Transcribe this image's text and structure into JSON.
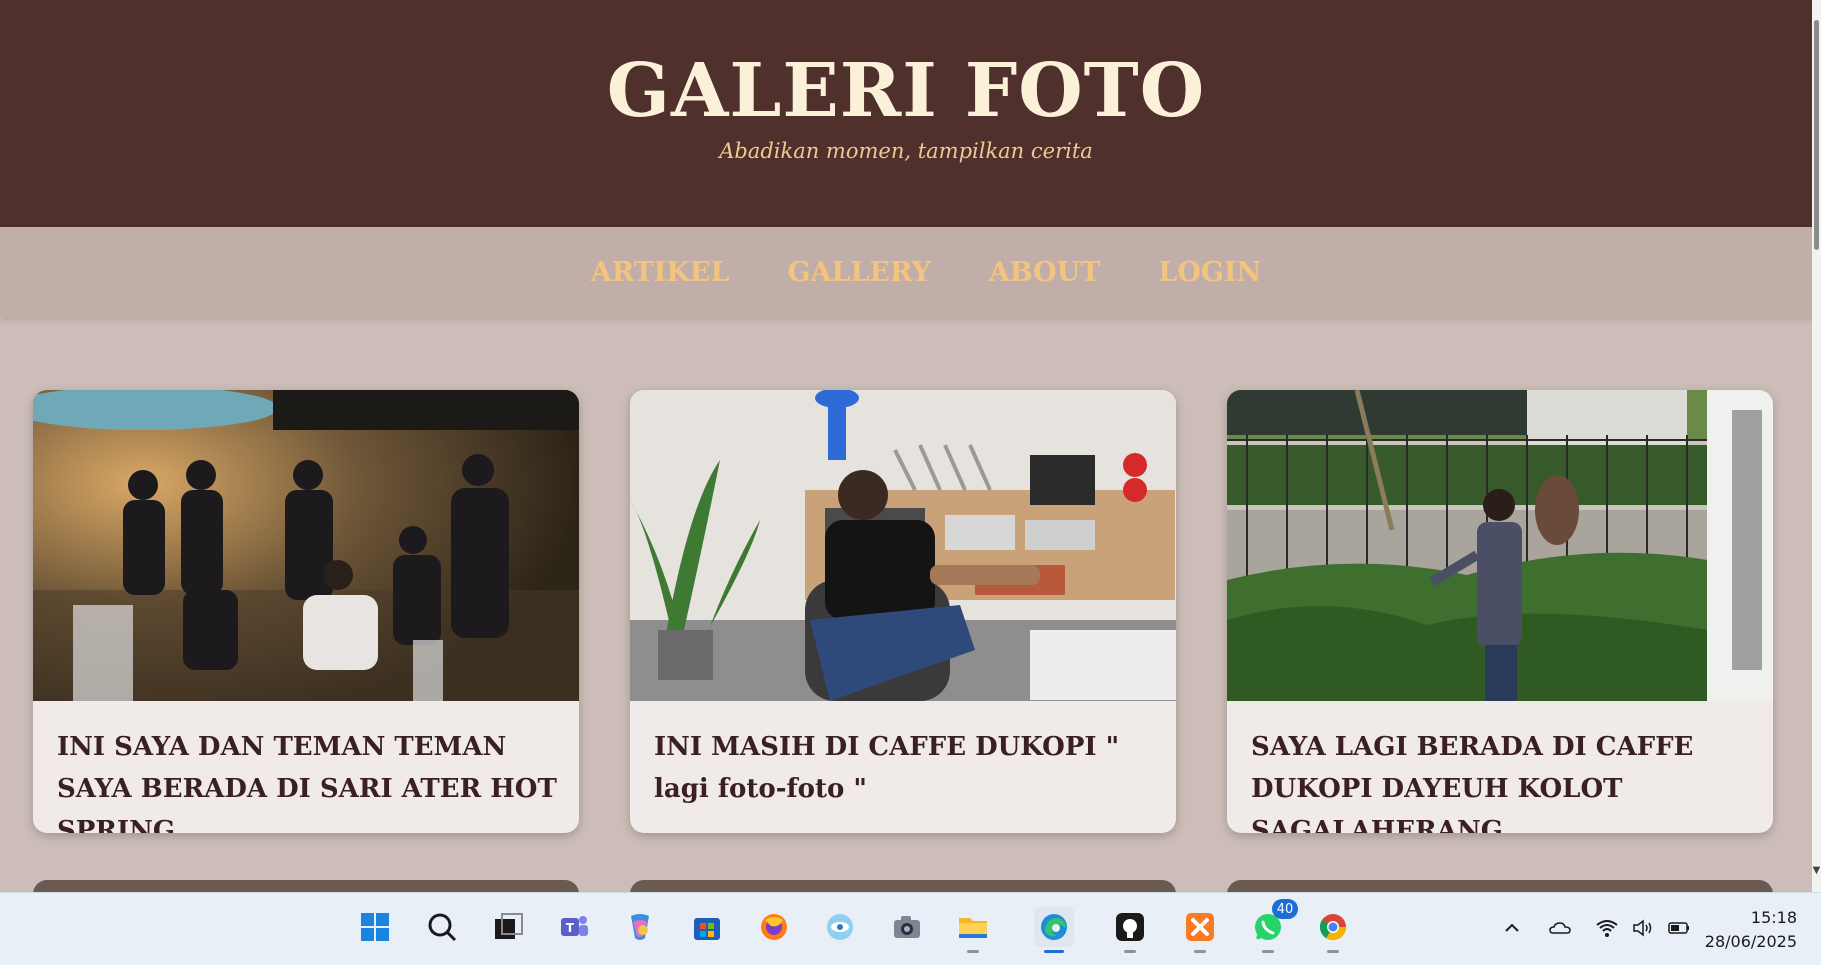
{
  "site": {
    "title": "GALERI FOTO",
    "tagline": "Abadikan momen, tampilkan cerita"
  },
  "nav": [
    {
      "label": "ARTIKEL"
    },
    {
      "label": "GALLERY"
    },
    {
      "label": "ABOUT"
    },
    {
      "label": "LOGIN"
    }
  ],
  "gallery": [
    {
      "caption": "INI SAYA DAN TEMAN TEMAN SAYA BERADA DI SARI ATER HOT SPRING",
      "photo": "group-photo-at-hot-spring"
    },
    {
      "caption": "INI MASIH DI CAFFE DUKOPI \" lagi foto-foto \"",
      "photo": "person-seated-in-cafe"
    },
    {
      "caption": "SAYA LAGI BERADA DI CAFFE DUKOPI DAYEUH KOLOT SAGALAHERANG",
      "photo": "person-standing-in-garden"
    }
  ],
  "taskbar": {
    "apps": [
      "windows-start-icon",
      "search-icon",
      "task-view-icon",
      "teams-icon",
      "copilot-icon",
      "store-icon",
      "firefox-icon",
      "eye-app-icon",
      "camera-icon",
      "file-explorer-icon",
      "edge-icon",
      "github-icon",
      "xampp-icon",
      "whatsapp-icon",
      "chrome-icon"
    ],
    "whatsapp_badge": "40",
    "tray": [
      "chevron-up-icon",
      "onedrive-icon",
      "wifi-icon",
      "volume-icon",
      "battery-icon"
    ],
    "time": "15:18",
    "date": "28/06/2025"
  },
  "colors": {
    "header_bg": "#4f302c",
    "nav_bg": "#c2aea8",
    "nav_text": "#f3c47f",
    "title_text": "#fbf1d9",
    "page_bg": "#cdbdb8",
    "card_bg": "#f0ebe9"
  }
}
